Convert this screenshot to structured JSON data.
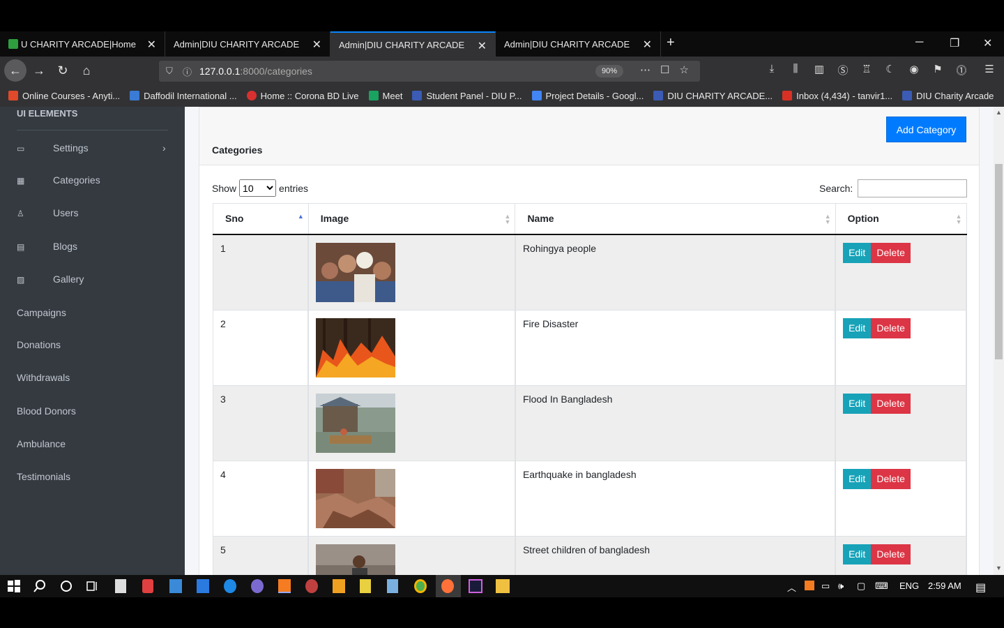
{
  "browser": {
    "tabs": [
      {
        "title": "U CHARITY ARCADE|Home",
        "active": false
      },
      {
        "title": "Admin|DIU CHARITY ARCADE",
        "active": false
      },
      {
        "title": "Admin|DIU CHARITY ARCADE",
        "active": true
      },
      {
        "title": "Admin|DIU CHARITY ARCADE",
        "active": false
      }
    ],
    "url_host": "127.0.0.1",
    "url_path": ":8000/categories",
    "zoom": "90%",
    "bookmarks": [
      {
        "label": "Online Courses - Anyti...",
        "color": "#e04a2a"
      },
      {
        "label": "Daffodil International ...",
        "color": "#3a7bd5"
      },
      {
        "label": "Home :: Corona BD Live",
        "color": "#d83030"
      },
      {
        "label": "Meet",
        "color": "#1aa260"
      },
      {
        "label": "Student Panel - DIU P...",
        "color": "#3b5bb5"
      },
      {
        "label": "Project Details - Googl...",
        "color": "#4285f4"
      },
      {
        "label": "DIU CHARITY ARCADE...",
        "color": "#3b5bb5"
      },
      {
        "label": "Inbox (4,434) - tanvir1...",
        "color": "#d93025"
      },
      {
        "label": "DIU Charity Arcade",
        "color": "#3b5bb5"
      }
    ]
  },
  "sidebar": {
    "heading": "UI ELEMENTS",
    "items_with_icons": [
      {
        "label": "Settings",
        "icon": "laptop-icon",
        "has_chevron": true
      },
      {
        "label": "Categories",
        "icon": "table-icon",
        "has_chevron": false
      },
      {
        "label": "Users",
        "icon": "user-icon",
        "has_chevron": false
      },
      {
        "label": "Blogs",
        "icon": "keyboard-icon",
        "has_chevron": false
      },
      {
        "label": "Gallery",
        "icon": "image-icon",
        "has_chevron": false
      }
    ],
    "items_plain": [
      "Campaigns",
      "Donations",
      "Withdrawals",
      "Blood Donors",
      "Ambulance",
      "Testimonials"
    ]
  },
  "content": {
    "title": "Categories",
    "add_button": "Add Category",
    "show_label": "Show",
    "entries_value": "10",
    "entries_label": "entries",
    "search_label": "Search:",
    "columns": [
      "Sno",
      "Image",
      "Name",
      "Option"
    ],
    "rows": [
      {
        "sno": "1",
        "name": "Rohingya people",
        "image_theme": "crowd"
      },
      {
        "sno": "2",
        "name": "Fire Disaster",
        "image_theme": "fire"
      },
      {
        "sno": "3",
        "name": "Flood In Bangladesh",
        "image_theme": "flood"
      },
      {
        "sno": "4",
        "name": "Earthquake in bangladesh",
        "image_theme": "rubble"
      },
      {
        "sno": "5",
        "name": "Street children of bangladesh",
        "image_theme": "child"
      }
    ],
    "edit_label": "Edit",
    "delete_label": "Delete"
  },
  "taskbar": {
    "language": "ENG",
    "time": "2:59 AM"
  }
}
